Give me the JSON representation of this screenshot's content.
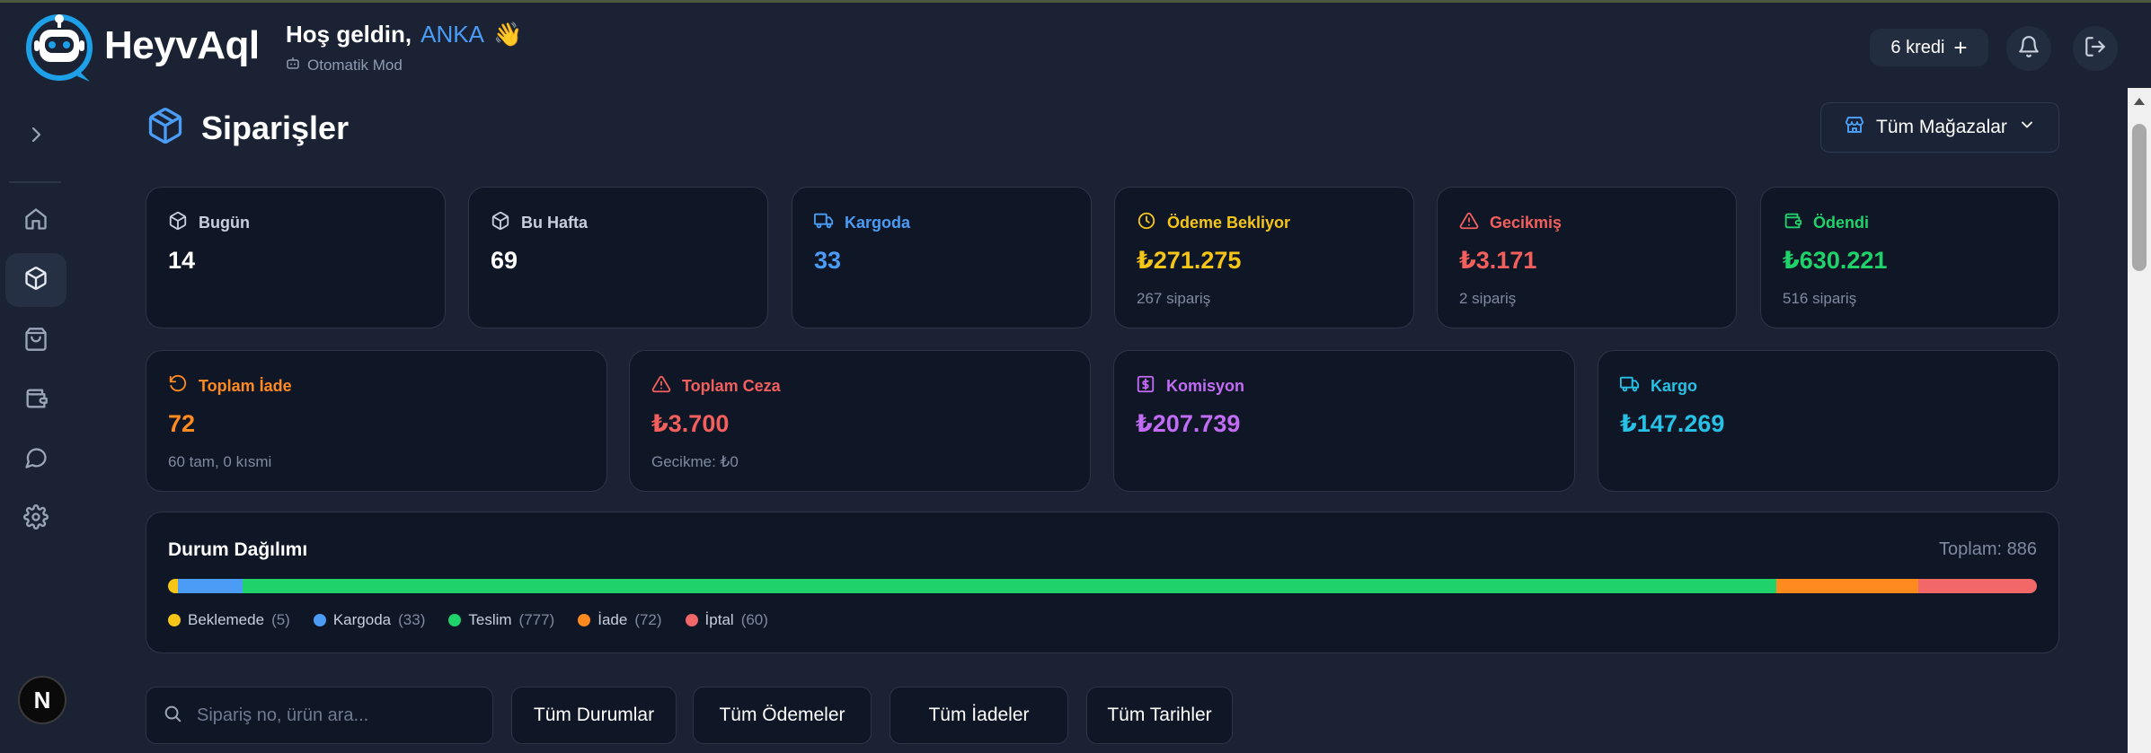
{
  "brand": {
    "name": "HeyvAql"
  },
  "header": {
    "greeting": "Hoş geldin,",
    "user_name": "ANKA",
    "wave_emoji": "👋",
    "mode_label": "Otomatik Mod",
    "credits_label": "6 kredi",
    "credits_add": "+"
  },
  "sidebar": {
    "items": [
      {
        "name": "expand",
        "icon": "chevron-right-icon"
      },
      {
        "name": "home",
        "icon": "home-icon"
      },
      {
        "name": "orders",
        "icon": "box-icon",
        "active": true
      },
      {
        "name": "shop",
        "icon": "shopping-bag-icon"
      },
      {
        "name": "wallet",
        "icon": "wallet-icon"
      },
      {
        "name": "messages",
        "icon": "chat-icon"
      },
      {
        "name": "settings",
        "icon": "gear-icon"
      }
    ],
    "avatar_letter": "N"
  },
  "page": {
    "title": "Siparişler",
    "store_selector": "Tüm Mağazalar"
  },
  "stats_row1": [
    {
      "label": "Bugün",
      "value": "14",
      "sub": "",
      "color": "#ffffff",
      "label_color": "#c7cfdc",
      "icon": "box-icon"
    },
    {
      "label": "Bu Hafta",
      "value": "69",
      "sub": "",
      "color": "#ffffff",
      "label_color": "#c7cfdc",
      "icon": "box-icon"
    },
    {
      "label": "Kargoda",
      "value": "33",
      "sub": "",
      "color": "#4a9cf5",
      "label_color": "#4a9cf5",
      "icon": "truck-icon"
    },
    {
      "label": "Ödeme Bekliyor",
      "value": "₺271.275",
      "sub": "267 sipariş",
      "color": "#f5c518",
      "label_color": "#f5c518",
      "icon": "clock-icon"
    },
    {
      "label": "Gecikmiş",
      "value": "₺3.171",
      "sub": "2 sipariş",
      "color": "#f25f5c",
      "label_color": "#f25f5c",
      "icon": "warning-icon"
    },
    {
      "label": "Ödendi",
      "value": "₺630.221",
      "sub": "516 sipariş",
      "color": "#1fd26a",
      "label_color": "#1fd26a",
      "icon": "wallet-icon"
    }
  ],
  "stats_row2": [
    {
      "label": "Toplam İade",
      "value": "72",
      "sub": "60 tam, 0 kısmi",
      "color": "#ff8a1f",
      "label_color": "#ff8a1f",
      "icon": "undo-icon"
    },
    {
      "label": "Toplam Ceza",
      "value": "₺3.700",
      "sub": "Gecikme: ₺0",
      "color": "#f25f5c",
      "label_color": "#f25f5c",
      "icon": "warning-icon"
    },
    {
      "label": "Komisyon",
      "value": "₺207.739",
      "sub": "",
      "color": "#c26cf5",
      "label_color": "#c26cf5",
      "icon": "dollar-icon"
    },
    {
      "label": "Kargo",
      "value": "₺147.269",
      "sub": "",
      "color": "#27c1e6",
      "label_color": "#27c1e6",
      "icon": "truck-icon"
    }
  ],
  "distribution": {
    "title": "Durum Dağılımı",
    "total_label": "Toplam: 886",
    "total": 886,
    "segments": [
      {
        "label": "Beklemede",
        "count": 5,
        "count_label": "(5)",
        "color": "#f5c518"
      },
      {
        "label": "Kargoda",
        "count": 33,
        "count_label": "(33)",
        "color": "#4a9cf5"
      },
      {
        "label": "Teslim",
        "count": 777,
        "count_label": "(777)",
        "color": "#1fd26a"
      },
      {
        "label": "İade",
        "count": 72,
        "count_label": "(72)",
        "color": "#ff8a1f"
      },
      {
        "label": "İptal",
        "count": 60,
        "count_label": "(60)",
        "color": "#f26868"
      }
    ]
  },
  "filters": {
    "search_placeholder": "Sipariş no, ürün ara...",
    "status": "Tüm Durumlar",
    "payments": "Tüm Ödemeler",
    "returns": "Tüm İadeler",
    "dates": "Tüm Tarihler"
  }
}
